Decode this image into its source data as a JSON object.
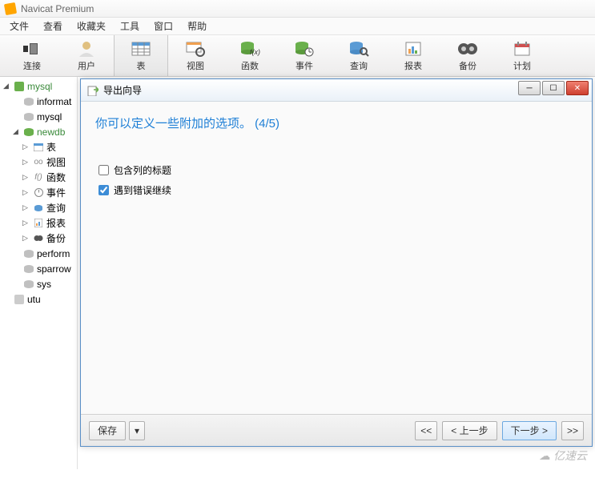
{
  "app": {
    "title": "Navicat Premium"
  },
  "menu": {
    "file": "文件",
    "view": "查看",
    "favorites": "收藏夹",
    "tools": "工具",
    "window": "窗口",
    "help": "帮助"
  },
  "toolbar": {
    "connect": "连接",
    "user": "用户",
    "table": "表",
    "view": "视图",
    "func": "函数",
    "event": "事件",
    "query": "查询",
    "report": "报表",
    "backup": "备份",
    "plan": "计划"
  },
  "tree": {
    "mysql": "mysql",
    "information": "informat",
    "mysql_db": "mysql",
    "newdb": "newdb",
    "table": "表",
    "view": "视图",
    "func": "函数",
    "event": "事件",
    "query": "查询",
    "report": "报表",
    "backup": "备份",
    "perform": "perform",
    "sparrow": "sparrow",
    "sys": "sys",
    "utu": "utu"
  },
  "dialog": {
    "title": "导出向导",
    "heading": "你可以定义一些附加的选项。 (4/5)",
    "chk_header": "包含列的标题",
    "chk_continue": "遇到错误继续",
    "save": "保存",
    "first": "<<",
    "prev": "< 上一步",
    "next": "下一步 >",
    "last": ">>"
  },
  "watermark": "亿速云"
}
